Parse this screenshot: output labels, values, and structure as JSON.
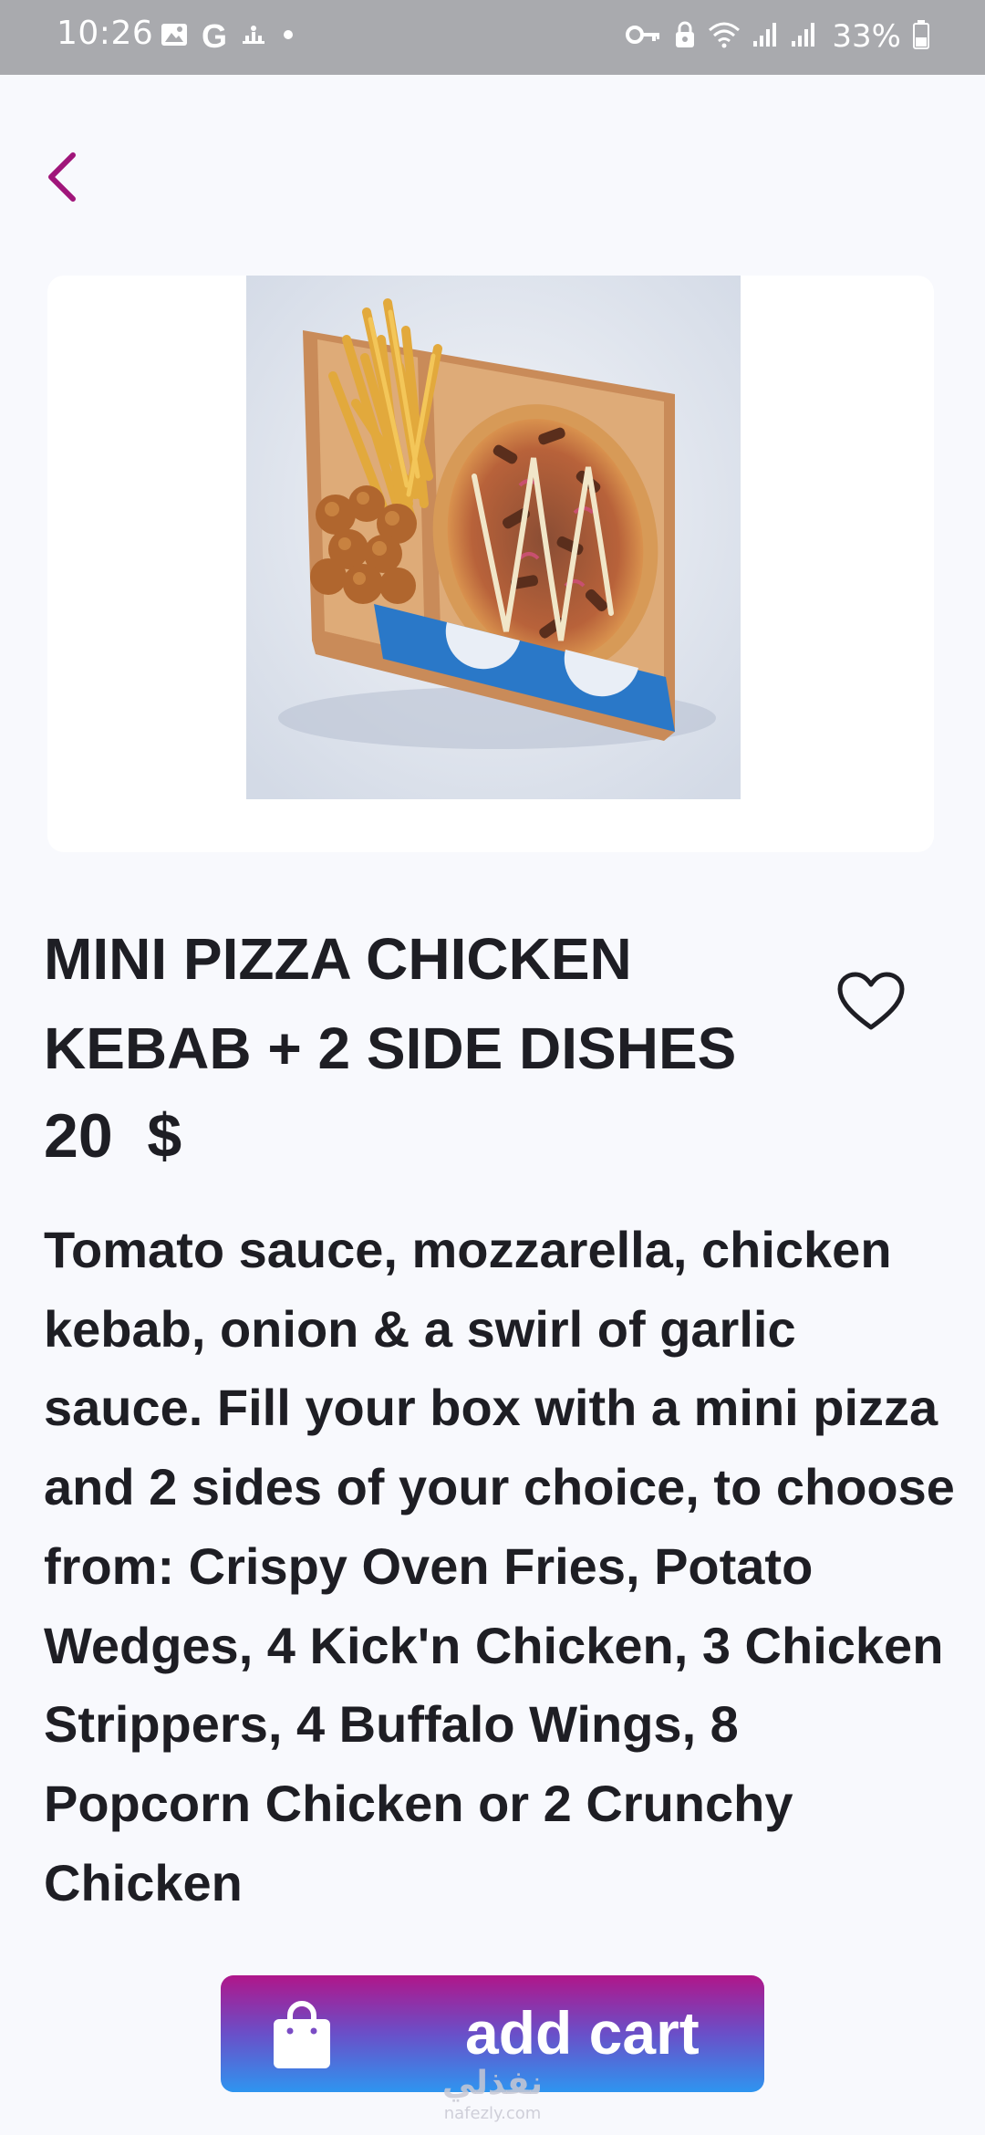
{
  "status_bar": {
    "time": "10:26",
    "battery": "33%",
    "left_icons": [
      "image-icon",
      "google-icon",
      "weather-icon",
      "dot-icon"
    ],
    "right_icons": [
      "key-icon",
      "lock-icon",
      "wifi-icon",
      "signal-icon",
      "signal-icon",
      "battery-icon"
    ]
  },
  "nav": {
    "back_icon": "chevron-left-icon",
    "accent_color": "#a0157a"
  },
  "product": {
    "image_alt": "Mini pizza chicken kebab box with fries and popcorn chicken",
    "title": "MINI PIZZA CHICKEN KEBAB + 2 SIDE DISHES",
    "price": "20  $",
    "favorite_icon": "heart-outline-icon",
    "description": "Tomato sauce, mozzarella, chicken kebab, onion & a swirl of garlic sauce. Fill your box with a mini pizza and 2 sides of your choice, to choose from: Crispy Oven Fries, Potato Wedges, 4 Kick'n Chicken, 3 Chicken Strippers, 4 Buffalo Wings, 8 Popcorn Chicken or 2 Crunchy Chicken"
  },
  "cart_button": {
    "label": "add cart",
    "icon": "shopping-bag-icon",
    "gradient": [
      "#b0168a",
      "#2e95f0"
    ]
  },
  "watermark": {
    "arabic": "نفذلي",
    "latin": "nafezly.com"
  }
}
